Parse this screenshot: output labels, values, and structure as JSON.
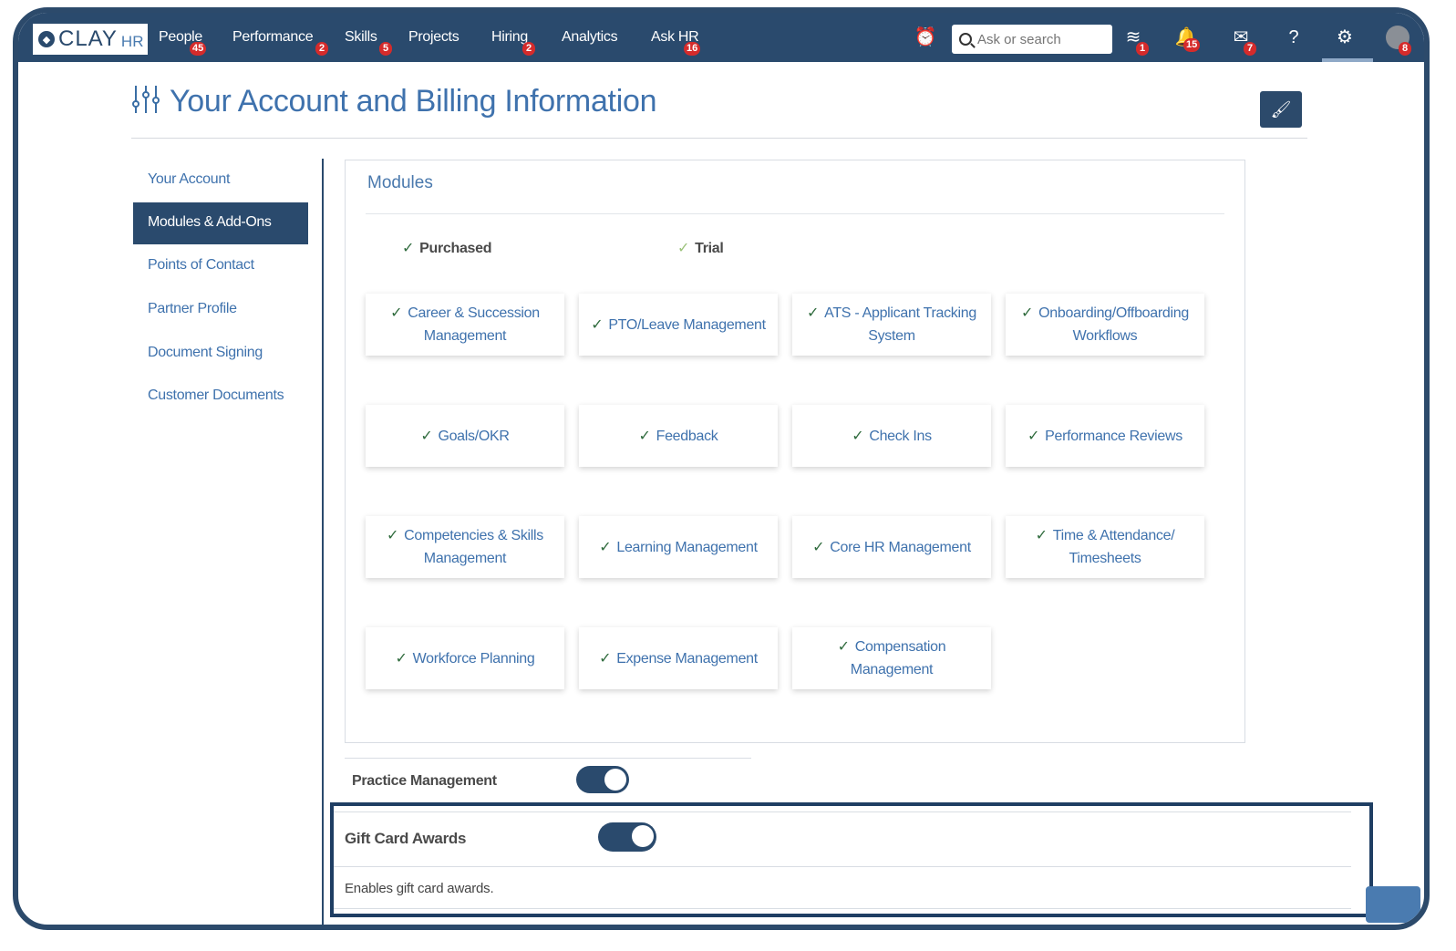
{
  "app": {
    "logo_text": "CLAY",
    "logo_suffix": "HR"
  },
  "nav": {
    "items": [
      {
        "label": "People",
        "badge": "45"
      },
      {
        "label": "Performance",
        "badge": "2"
      },
      {
        "label": "Skills",
        "badge": "5"
      },
      {
        "label": "Projects",
        "badge": ""
      },
      {
        "label": "Hiring",
        "badge": "2"
      },
      {
        "label": "Analytics",
        "badge": ""
      },
      {
        "label": "Ask HR",
        "badge": "16"
      }
    ],
    "search_placeholder": "Ask or search",
    "icons": [
      {
        "name": "alarm-icon",
        "badge": ""
      },
      {
        "name": "layers-icon",
        "badge": "1"
      },
      {
        "name": "bell-icon",
        "badge": "15"
      },
      {
        "name": "mail-icon",
        "badge": "7"
      },
      {
        "name": "help-icon",
        "badge": ""
      },
      {
        "name": "gear-icon",
        "badge": ""
      },
      {
        "name": "avatar",
        "badge": "8"
      }
    ],
    "colors": {
      "bar": "#2a4a6d",
      "badge": "#d52b2b"
    }
  },
  "page": {
    "title": "Your Account and Billing Information"
  },
  "sidebar": {
    "items": [
      {
        "label": "Your Account",
        "active": false
      },
      {
        "label": "Modules & Add-Ons",
        "active": true
      },
      {
        "label": "Points of Contact",
        "active": false
      },
      {
        "label": "Partner Profile",
        "active": false
      },
      {
        "label": "Document Signing",
        "active": false
      },
      {
        "label": "Customer Documents",
        "active": false
      }
    ]
  },
  "modules": {
    "title": "Modules",
    "legend": {
      "purchased": "Purchased",
      "trial": "Trial"
    },
    "check": "✓",
    "cards": [
      "Career & Succession Management",
      "PTO/Leave Management",
      "ATS - Applicant Tracking System",
      "Onboarding/Offboarding Workflows",
      "Goals/OKR",
      "Feedback",
      "Check Ins",
      "Performance Reviews",
      "Competencies & Skills Management",
      "Learning Management",
      "Core HR Management",
      "Time & Attendance/ Timesheets",
      "Workforce Planning",
      "Expense Management",
      "Compensation Management"
    ]
  },
  "addons": {
    "practice_management": {
      "label": "Practice Management",
      "enabled": true
    },
    "gift_card_awards": {
      "label": "Gift Card Awards",
      "enabled": true,
      "description": "Enables gift card awards."
    }
  }
}
